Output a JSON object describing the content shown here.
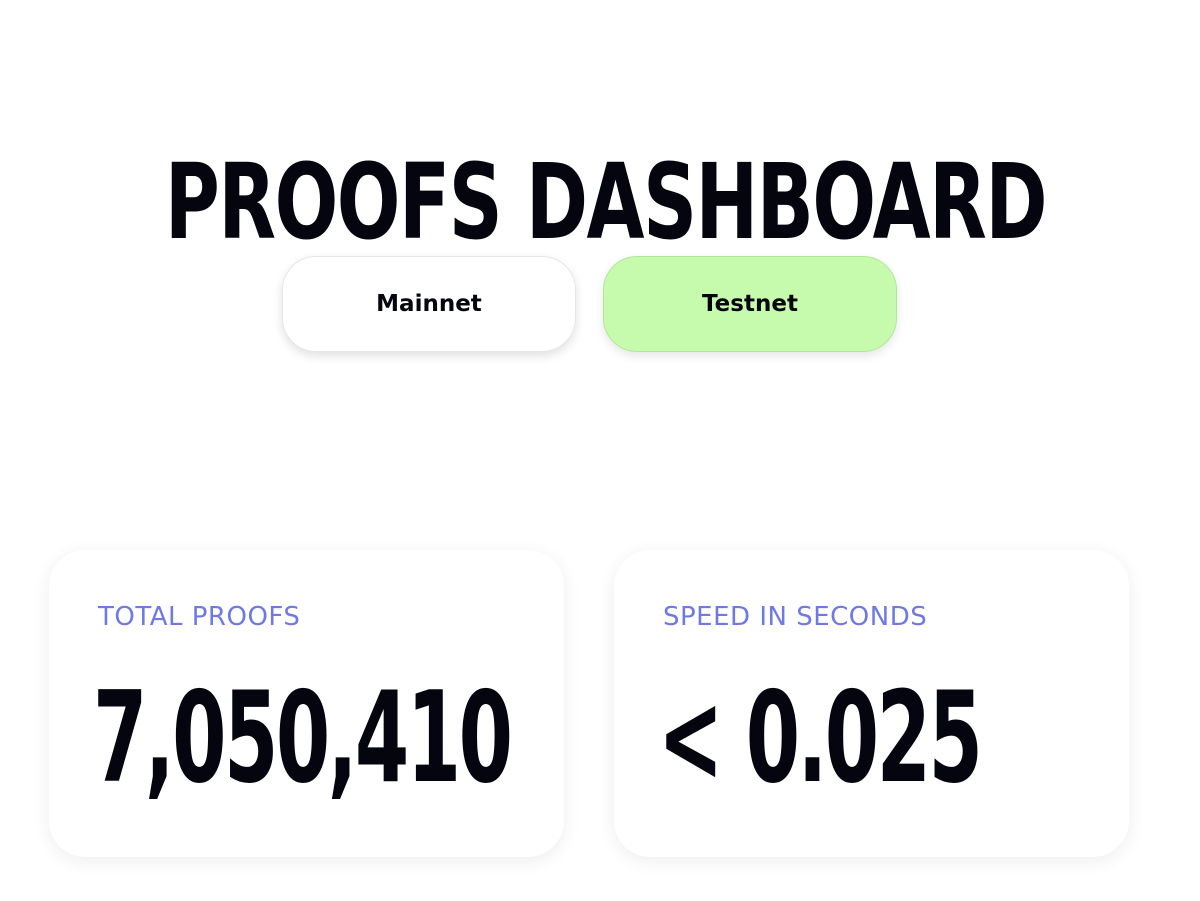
{
  "header": {
    "title": "PROOFS DASHBOARD"
  },
  "network_tabs": {
    "selected": "Testnet",
    "items": [
      {
        "label": "Mainnet"
      },
      {
        "label": "Testnet"
      }
    ]
  },
  "stats": {
    "total_proofs": {
      "label": "TOTAL PROOFS",
      "value": "7,050,410"
    },
    "speed": {
      "label": "SPEED IN SECONDS",
      "value": "< 0.025"
    }
  },
  "colors": {
    "text": "#05050f",
    "accent_label": "#6f78e4",
    "selected_tab": "#c6fbad",
    "background": "#ffffff"
  }
}
